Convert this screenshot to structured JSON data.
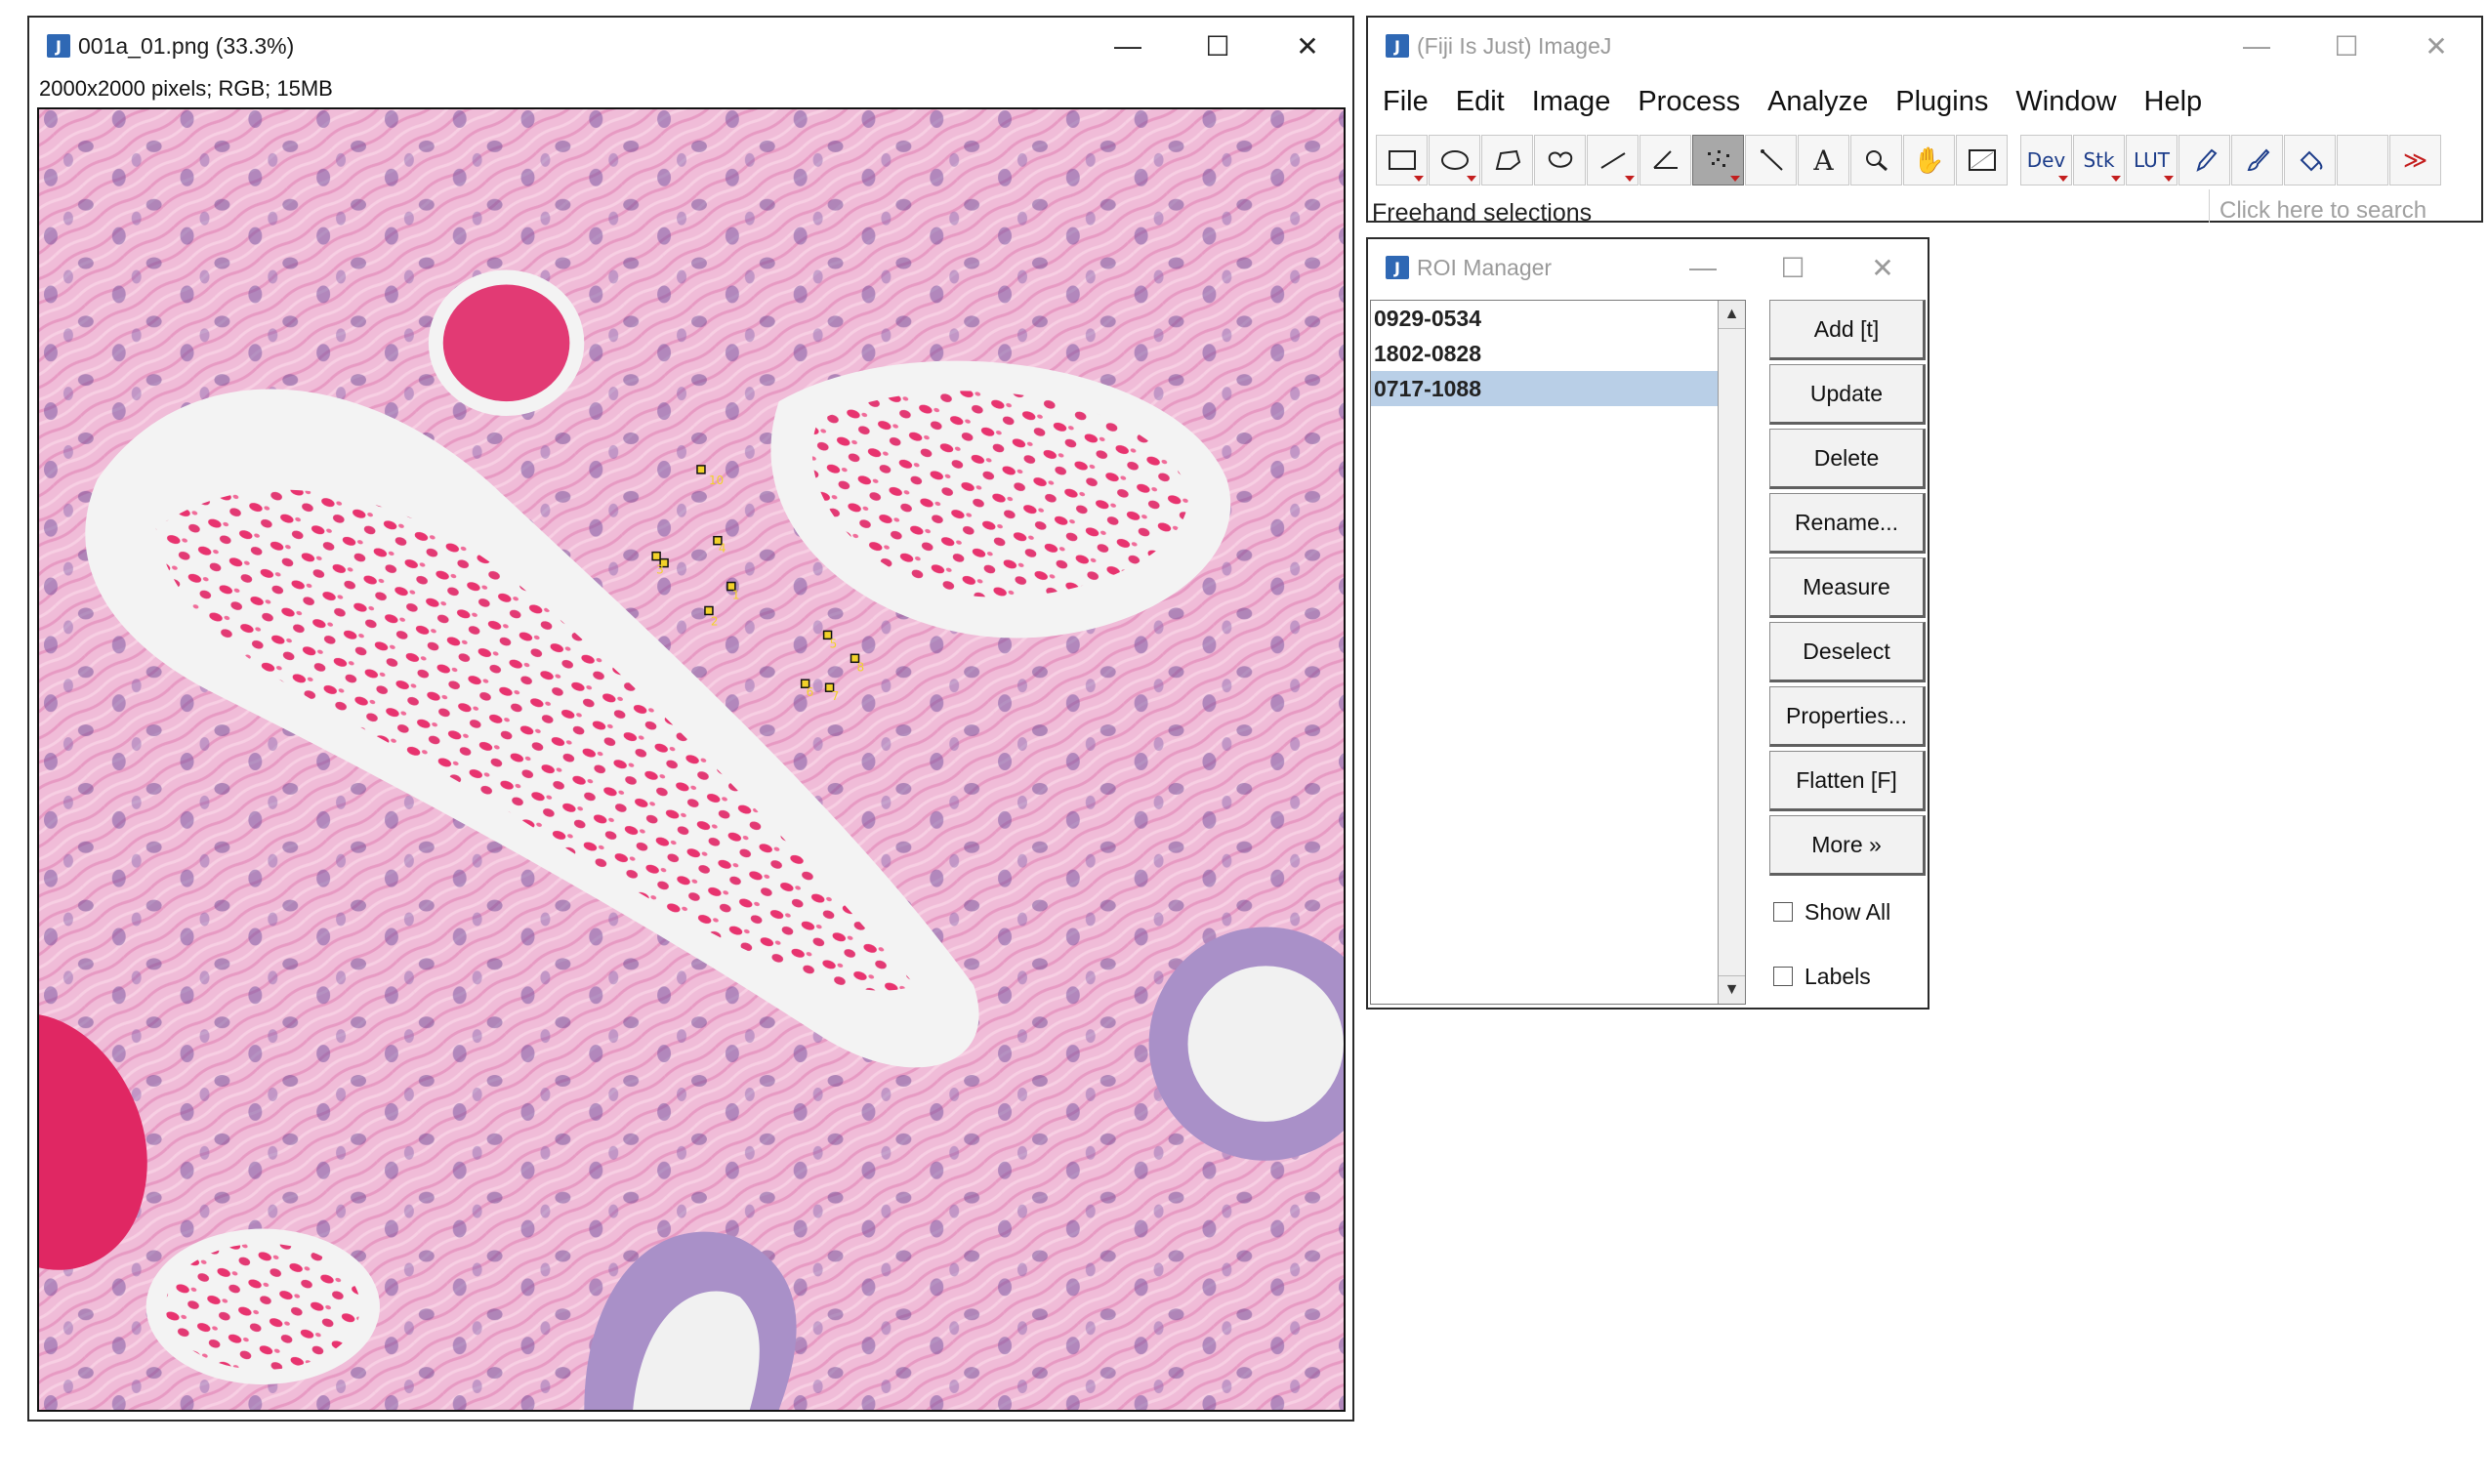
{
  "image_window": {
    "title": "001a_01.png (33.3%)",
    "info": "2000x2000 pixels; RGB; 15MB",
    "controls": {
      "minimize": "—",
      "maximize": "☐",
      "close": "✕"
    },
    "point_labels": [
      "10",
      "3",
      "4",
      "2",
      "1",
      "5",
      "8",
      "6",
      "7"
    ]
  },
  "imagej_window": {
    "title": "(Fiji Is Just) ImageJ",
    "menu": [
      "File",
      "Edit",
      "Image",
      "Process",
      "Analyze",
      "Plugins",
      "Window",
      "Help"
    ],
    "tools": {
      "dev": "Dev",
      "stk": "Stk",
      "lut": "LUT",
      "more": "≫"
    },
    "status": "Freehand selections",
    "search_placeholder": "Click here to search"
  },
  "roi_manager": {
    "title": "ROI Manager",
    "items": [
      "0929-0534",
      "1802-0828",
      "0717-1088"
    ],
    "selected_index": 2,
    "buttons": [
      "Add [t]",
      "Update",
      "Delete",
      "Rename...",
      "Measure",
      "Deselect",
      "Properties...",
      "Flatten [F]",
      "More »"
    ],
    "checkboxes": [
      "Show All",
      "Labels"
    ]
  },
  "colors": {
    "accent": "#2f68b4",
    "selection": "#b9cfe7",
    "tissue_pink": "#f0bcd8",
    "blood_red": "#e8336f",
    "nucleus_purple": "#6b4a9b",
    "point_yellow": "#f2d22a"
  }
}
